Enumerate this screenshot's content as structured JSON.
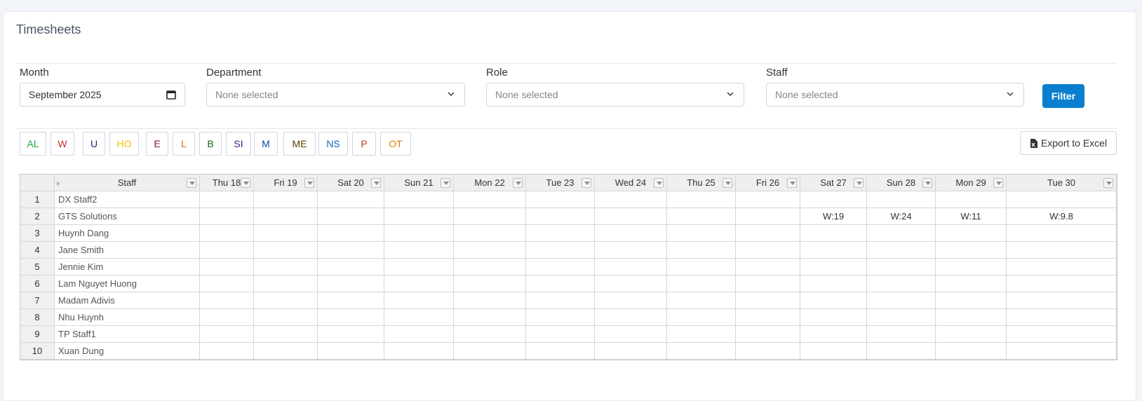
{
  "page": {
    "title": "Timesheets"
  },
  "filters": {
    "month": {
      "label": "Month",
      "value": "September  2025"
    },
    "department": {
      "label": "Department",
      "placeholder": "None selected"
    },
    "role": {
      "label": "Role",
      "placeholder": "None selected"
    },
    "staff": {
      "label": "Staff",
      "placeholder": "None selected"
    },
    "filter_button": "Filter"
  },
  "legend": [
    {
      "code": "AL",
      "color": "#19a845"
    },
    {
      "code": "W",
      "color": "#c62828"
    },
    {
      "code": "U",
      "color": "#1a237e"
    },
    {
      "code": "HO",
      "color": "#f2c200"
    },
    {
      "code": "E",
      "color": "#880e4f"
    },
    {
      "code": "L",
      "color": "#ef6c00"
    },
    {
      "code": "B",
      "color": "#1b5e20"
    },
    {
      "code": "SI",
      "color": "#4a148c"
    },
    {
      "code": "M",
      "color": "#0d47a1"
    },
    {
      "code": "ME",
      "color": "#5d3a00"
    },
    {
      "code": "NS",
      "color": "#1565c0"
    },
    {
      "code": "P",
      "color": "#bf360c"
    },
    {
      "code": "OT",
      "color": "#e07b00"
    }
  ],
  "export_button": "Export to Excel",
  "table": {
    "staff_header": "Staff",
    "date_headers": [
      "Thu 18",
      "Fri 19",
      "Sat 20",
      "Sun 21",
      "Mon 22",
      "Tue 23",
      "Wed 24",
      "Thu 25",
      "Fri 26",
      "Sat 27",
      "Sun 28",
      "Mon 29",
      "Tue 30"
    ],
    "rows": [
      {
        "num": "1",
        "name": "DX Staff2",
        "values": [
          "",
          "",
          "",
          "",
          "",
          "",
          "",
          "",
          "",
          "",
          "",
          "",
          ""
        ]
      },
      {
        "num": "2",
        "name": "GTS Solutions",
        "values": [
          "",
          "",
          "",
          "",
          "",
          "",
          "",
          "",
          "",
          "W:19",
          "W:24",
          "W:11",
          "W:9.8"
        ]
      },
      {
        "num": "3",
        "name": "Huynh Dang",
        "values": [
          "",
          "",
          "",
          "",
          "",
          "",
          "",
          "",
          "",
          "",
          "",
          "",
          ""
        ]
      },
      {
        "num": "4",
        "name": "Jane Smith",
        "values": [
          "",
          "",
          "",
          "",
          "",
          "",
          "",
          "",
          "",
          "",
          "",
          "",
          ""
        ]
      },
      {
        "num": "5",
        "name": "Jennie  Kim",
        "values": [
          "",
          "",
          "",
          "",
          "",
          "",
          "",
          "",
          "",
          "",
          "",
          "",
          ""
        ]
      },
      {
        "num": "6",
        "name": "Lam Nguyet Huong",
        "values": [
          "",
          "",
          "",
          "",
          "",
          "",
          "",
          "",
          "",
          "",
          "",
          "",
          ""
        ]
      },
      {
        "num": "7",
        "name": "Madam Adivis",
        "values": [
          "",
          "",
          "",
          "",
          "",
          "",
          "",
          "",
          "",
          "",
          "",
          "",
          ""
        ]
      },
      {
        "num": "8",
        "name": "Nhu Huynh",
        "values": [
          "",
          "",
          "",
          "",
          "",
          "",
          "",
          "",
          "",
          "",
          "",
          "",
          ""
        ]
      },
      {
        "num": "9",
        "name": "TP Staff1",
        "values": [
          "",
          "",
          "",
          "",
          "",
          "",
          "",
          "",
          "",
          "",
          "",
          "",
          ""
        ]
      },
      {
        "num": "10",
        "name": "Xuan Dung",
        "values": [
          "",
          "",
          "",
          "",
          "",
          "",
          "",
          "",
          "",
          "",
          "",
          "",
          ""
        ]
      }
    ]
  }
}
